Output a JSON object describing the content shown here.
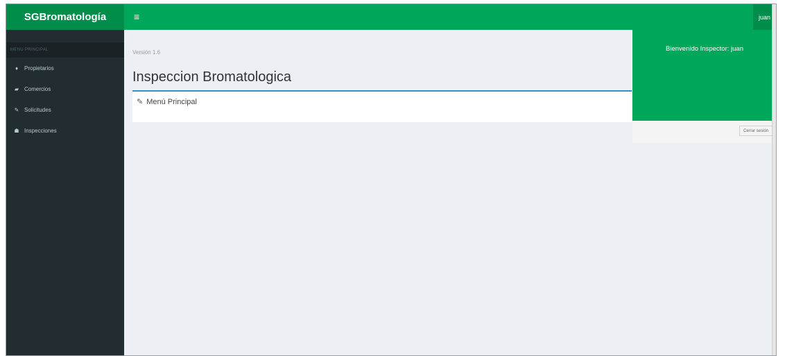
{
  "app": {
    "logo": "SGBromatología",
    "version": "Versión 1.6",
    "user": "juan"
  },
  "sidebar": {
    "header": "MENU PRINCIPAL",
    "items": [
      {
        "label": "Propietarios",
        "icon": "user-icon"
      },
      {
        "label": "Comercios",
        "icon": "book-icon"
      },
      {
        "label": "Solicitudes",
        "icon": "edit-icon"
      },
      {
        "label": "Inspecciones",
        "icon": "users-icon"
      }
    ]
  },
  "main": {
    "title": "Inspeccion Bromatologica",
    "box_title": "Menú Principal"
  },
  "user_menu": {
    "welcome": "Bienvenido Inspector: juan",
    "logout": "Cerrar sesión"
  },
  "colors": {
    "primary": "#00a65a",
    "primary_dark": "#008d4c",
    "sidebar": "#222d32",
    "accent": "#3c8dbc"
  }
}
